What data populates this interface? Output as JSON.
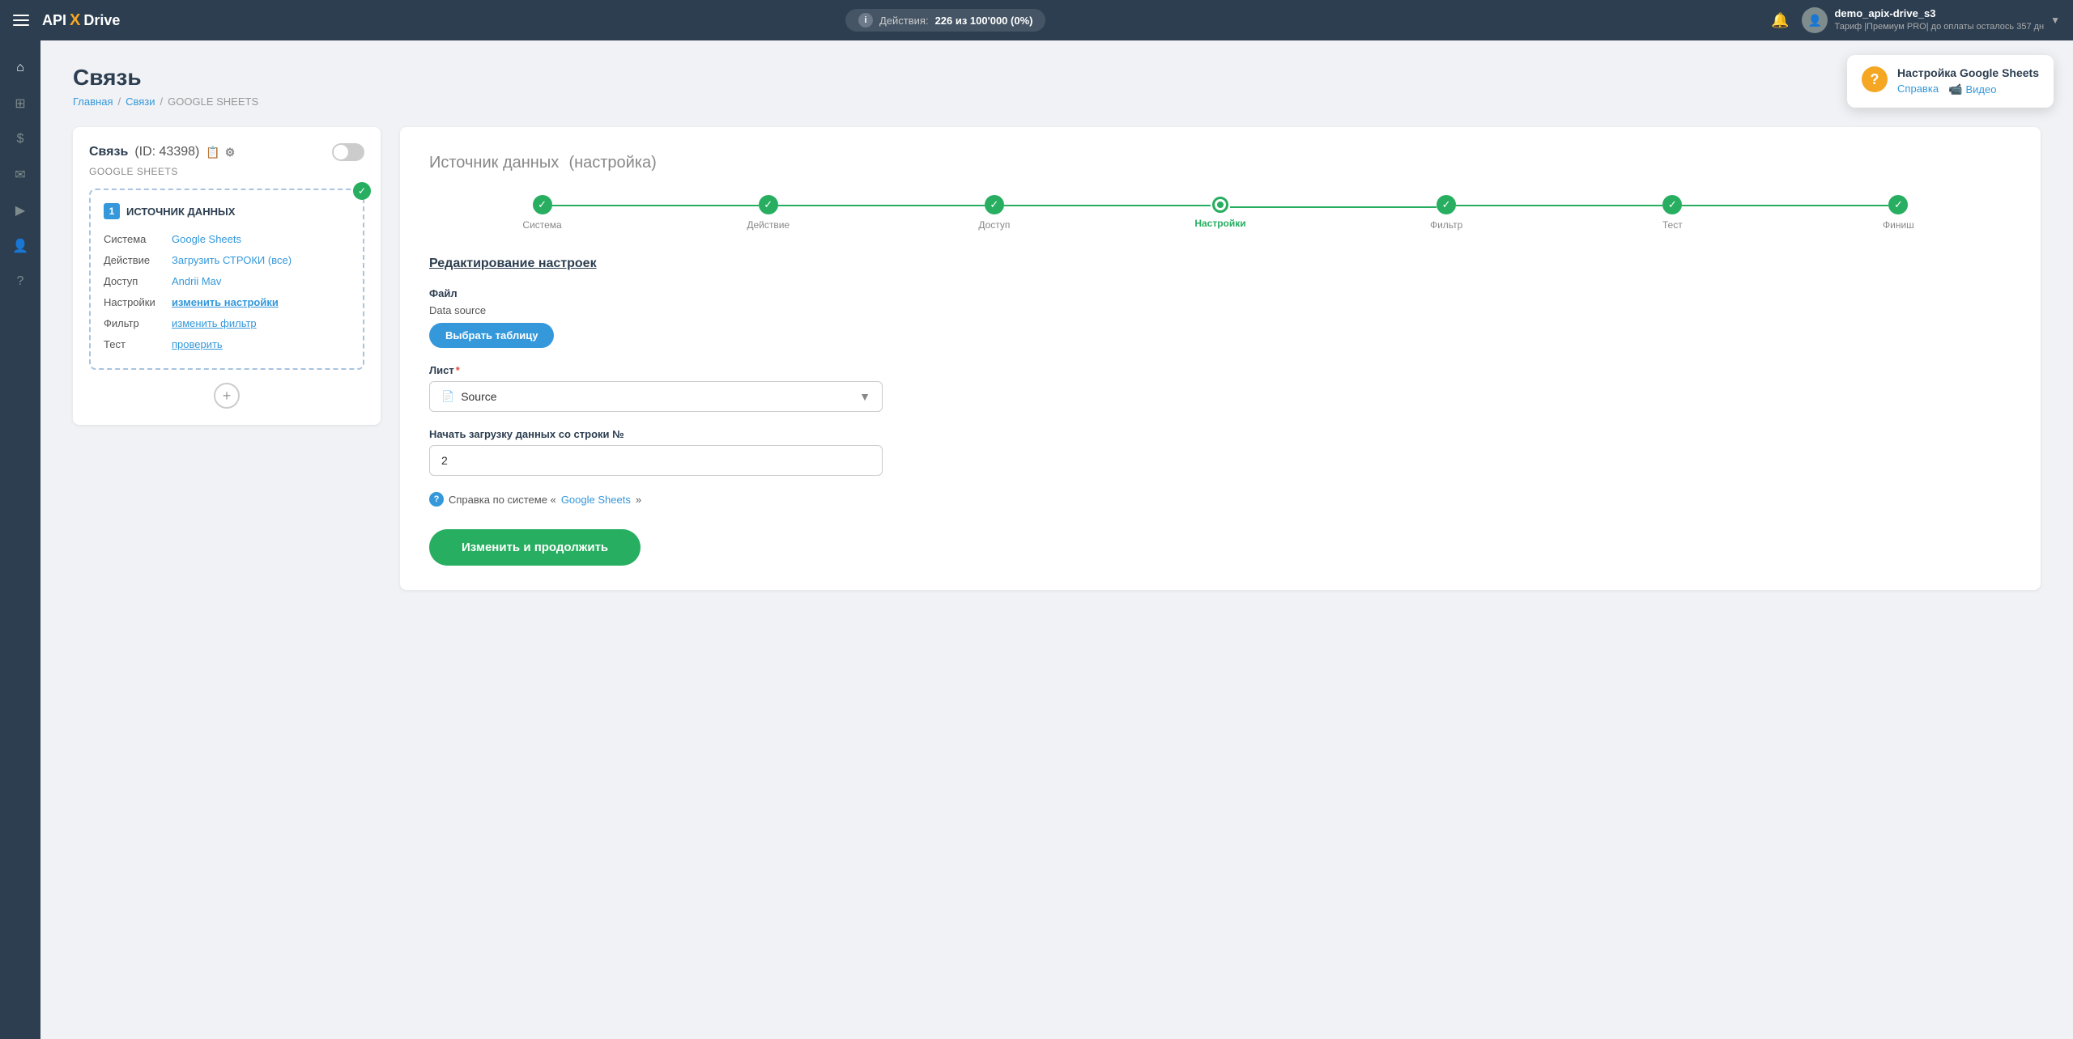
{
  "navbar": {
    "brand": {
      "api": "API",
      "x": "X",
      "drive": "Drive"
    },
    "actions": {
      "label": "Действия:",
      "count": "226 из 100'000 (0%)"
    },
    "user": {
      "name": "demo_apix-drive_s3",
      "tariff": "Тариф |Премиум PRO| до оплаты осталось 357 дн"
    }
  },
  "sidebar": {
    "items": [
      {
        "icon": "⌂",
        "label": "home-icon"
      },
      {
        "icon": "⊞",
        "label": "grid-icon"
      },
      {
        "icon": "$",
        "label": "dollar-icon"
      },
      {
        "icon": "✉",
        "label": "mail-icon"
      },
      {
        "icon": "▶",
        "label": "play-icon"
      },
      {
        "icon": "👤",
        "label": "user-icon"
      },
      {
        "icon": "?",
        "label": "help-icon"
      }
    ]
  },
  "page": {
    "title": "Связь",
    "breadcrumb": {
      "home": "Главная",
      "connections": "Связи",
      "current": "GOOGLE SHEETS"
    }
  },
  "connection_card": {
    "title": "Связь",
    "id": "(ID: 43398)",
    "service": "GOOGLE SHEETS",
    "datasource": {
      "number": "1",
      "label": "ИСТОЧНИК ДАННЫХ",
      "rows": [
        {
          "key": "Система",
          "value": "Google Sheets",
          "type": "link"
        },
        {
          "key": "Действие",
          "value": "Загрузить СТРОКИ (все)",
          "type": "link"
        },
        {
          "key": "Доступ",
          "value": "Andrii Mav",
          "type": "link"
        },
        {
          "key": "Настройки",
          "value": "изменить настройки",
          "type": "bold-underline"
        },
        {
          "key": "Фильтр",
          "value": "изменить фильтр",
          "type": "underline"
        },
        {
          "key": "Тест",
          "value": "проверить",
          "type": "underline"
        }
      ]
    }
  },
  "settings_panel": {
    "title": "Источник данных",
    "subtitle": "(настройка)",
    "steps": [
      {
        "label": "Система",
        "state": "done"
      },
      {
        "label": "Действие",
        "state": "done"
      },
      {
        "label": "Доступ",
        "state": "done"
      },
      {
        "label": "Настройки",
        "state": "active"
      },
      {
        "label": "Фильтр",
        "state": "done"
      },
      {
        "label": "Тест",
        "state": "done"
      },
      {
        "label": "Финиш",
        "state": "done"
      }
    ],
    "edit_title": "Редактирование настроек",
    "file_label": "Файл",
    "file_value": "Data source",
    "select_table_btn": "Выбрать таблицу",
    "sheet_label": "Лист",
    "sheet_required": "*",
    "sheet_value": "Source",
    "start_row_label": "Начать загрузку данных со строки №",
    "start_row_value": "2",
    "help_text": "Справка по системе «Google Sheets»",
    "submit_btn": "Изменить и продолжить"
  },
  "help_tooltip": {
    "title": "Настройка Google Sheets",
    "link_help": "Справка",
    "link_video": "Видео"
  }
}
